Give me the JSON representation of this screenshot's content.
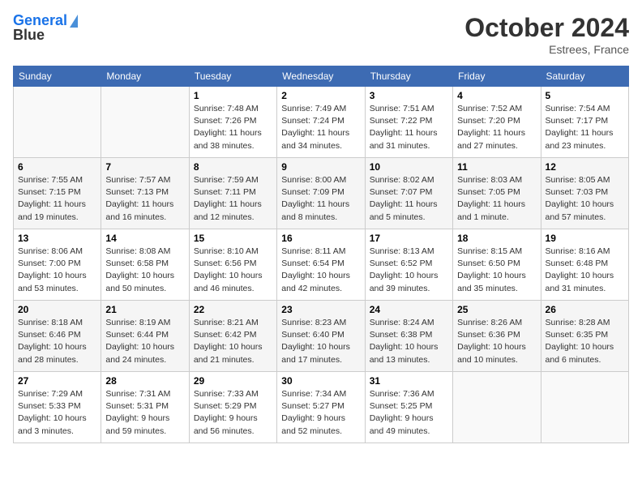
{
  "header": {
    "logo_line1": "General",
    "logo_line2": "Blue",
    "month": "October 2024",
    "location": "Estrees, France"
  },
  "weekdays": [
    "Sunday",
    "Monday",
    "Tuesday",
    "Wednesday",
    "Thursday",
    "Friday",
    "Saturday"
  ],
  "weeks": [
    [
      {
        "day": null,
        "sunrise": null,
        "sunset": null,
        "daylight": null
      },
      {
        "day": null,
        "sunrise": null,
        "sunset": null,
        "daylight": null
      },
      {
        "day": "1",
        "sunrise": "Sunrise: 7:48 AM",
        "sunset": "Sunset: 7:26 PM",
        "daylight": "Daylight: 11 hours and 38 minutes."
      },
      {
        "day": "2",
        "sunrise": "Sunrise: 7:49 AM",
        "sunset": "Sunset: 7:24 PM",
        "daylight": "Daylight: 11 hours and 34 minutes."
      },
      {
        "day": "3",
        "sunrise": "Sunrise: 7:51 AM",
        "sunset": "Sunset: 7:22 PM",
        "daylight": "Daylight: 11 hours and 31 minutes."
      },
      {
        "day": "4",
        "sunrise": "Sunrise: 7:52 AM",
        "sunset": "Sunset: 7:20 PM",
        "daylight": "Daylight: 11 hours and 27 minutes."
      },
      {
        "day": "5",
        "sunrise": "Sunrise: 7:54 AM",
        "sunset": "Sunset: 7:17 PM",
        "daylight": "Daylight: 11 hours and 23 minutes."
      }
    ],
    [
      {
        "day": "6",
        "sunrise": "Sunrise: 7:55 AM",
        "sunset": "Sunset: 7:15 PM",
        "daylight": "Daylight: 11 hours and 19 minutes."
      },
      {
        "day": "7",
        "sunrise": "Sunrise: 7:57 AM",
        "sunset": "Sunset: 7:13 PM",
        "daylight": "Daylight: 11 hours and 16 minutes."
      },
      {
        "day": "8",
        "sunrise": "Sunrise: 7:59 AM",
        "sunset": "Sunset: 7:11 PM",
        "daylight": "Daylight: 11 hours and 12 minutes."
      },
      {
        "day": "9",
        "sunrise": "Sunrise: 8:00 AM",
        "sunset": "Sunset: 7:09 PM",
        "daylight": "Daylight: 11 hours and 8 minutes."
      },
      {
        "day": "10",
        "sunrise": "Sunrise: 8:02 AM",
        "sunset": "Sunset: 7:07 PM",
        "daylight": "Daylight: 11 hours and 5 minutes."
      },
      {
        "day": "11",
        "sunrise": "Sunrise: 8:03 AM",
        "sunset": "Sunset: 7:05 PM",
        "daylight": "Daylight: 11 hours and 1 minute."
      },
      {
        "day": "12",
        "sunrise": "Sunrise: 8:05 AM",
        "sunset": "Sunset: 7:03 PM",
        "daylight": "Daylight: 10 hours and 57 minutes."
      }
    ],
    [
      {
        "day": "13",
        "sunrise": "Sunrise: 8:06 AM",
        "sunset": "Sunset: 7:00 PM",
        "daylight": "Daylight: 10 hours and 53 minutes."
      },
      {
        "day": "14",
        "sunrise": "Sunrise: 8:08 AM",
        "sunset": "Sunset: 6:58 PM",
        "daylight": "Daylight: 10 hours and 50 minutes."
      },
      {
        "day": "15",
        "sunrise": "Sunrise: 8:10 AM",
        "sunset": "Sunset: 6:56 PM",
        "daylight": "Daylight: 10 hours and 46 minutes."
      },
      {
        "day": "16",
        "sunrise": "Sunrise: 8:11 AM",
        "sunset": "Sunset: 6:54 PM",
        "daylight": "Daylight: 10 hours and 42 minutes."
      },
      {
        "day": "17",
        "sunrise": "Sunrise: 8:13 AM",
        "sunset": "Sunset: 6:52 PM",
        "daylight": "Daylight: 10 hours and 39 minutes."
      },
      {
        "day": "18",
        "sunrise": "Sunrise: 8:15 AM",
        "sunset": "Sunset: 6:50 PM",
        "daylight": "Daylight: 10 hours and 35 minutes."
      },
      {
        "day": "19",
        "sunrise": "Sunrise: 8:16 AM",
        "sunset": "Sunset: 6:48 PM",
        "daylight": "Daylight: 10 hours and 31 minutes."
      }
    ],
    [
      {
        "day": "20",
        "sunrise": "Sunrise: 8:18 AM",
        "sunset": "Sunset: 6:46 PM",
        "daylight": "Daylight: 10 hours and 28 minutes."
      },
      {
        "day": "21",
        "sunrise": "Sunrise: 8:19 AM",
        "sunset": "Sunset: 6:44 PM",
        "daylight": "Daylight: 10 hours and 24 minutes."
      },
      {
        "day": "22",
        "sunrise": "Sunrise: 8:21 AM",
        "sunset": "Sunset: 6:42 PM",
        "daylight": "Daylight: 10 hours and 21 minutes."
      },
      {
        "day": "23",
        "sunrise": "Sunrise: 8:23 AM",
        "sunset": "Sunset: 6:40 PM",
        "daylight": "Daylight: 10 hours and 17 minutes."
      },
      {
        "day": "24",
        "sunrise": "Sunrise: 8:24 AM",
        "sunset": "Sunset: 6:38 PM",
        "daylight": "Daylight: 10 hours and 13 minutes."
      },
      {
        "day": "25",
        "sunrise": "Sunrise: 8:26 AM",
        "sunset": "Sunset: 6:36 PM",
        "daylight": "Daylight: 10 hours and 10 minutes."
      },
      {
        "day": "26",
        "sunrise": "Sunrise: 8:28 AM",
        "sunset": "Sunset: 6:35 PM",
        "daylight": "Daylight: 10 hours and 6 minutes."
      }
    ],
    [
      {
        "day": "27",
        "sunrise": "Sunrise: 7:29 AM",
        "sunset": "Sunset: 5:33 PM",
        "daylight": "Daylight: 10 hours and 3 minutes."
      },
      {
        "day": "28",
        "sunrise": "Sunrise: 7:31 AM",
        "sunset": "Sunset: 5:31 PM",
        "daylight": "Daylight: 9 hours and 59 minutes."
      },
      {
        "day": "29",
        "sunrise": "Sunrise: 7:33 AM",
        "sunset": "Sunset: 5:29 PM",
        "daylight": "Daylight: 9 hours and 56 minutes."
      },
      {
        "day": "30",
        "sunrise": "Sunrise: 7:34 AM",
        "sunset": "Sunset: 5:27 PM",
        "daylight": "Daylight: 9 hours and 52 minutes."
      },
      {
        "day": "31",
        "sunrise": "Sunrise: 7:36 AM",
        "sunset": "Sunset: 5:25 PM",
        "daylight": "Daylight: 9 hours and 49 minutes."
      },
      {
        "day": null,
        "sunrise": null,
        "sunset": null,
        "daylight": null
      },
      {
        "day": null,
        "sunrise": null,
        "sunset": null,
        "daylight": null
      }
    ]
  ]
}
